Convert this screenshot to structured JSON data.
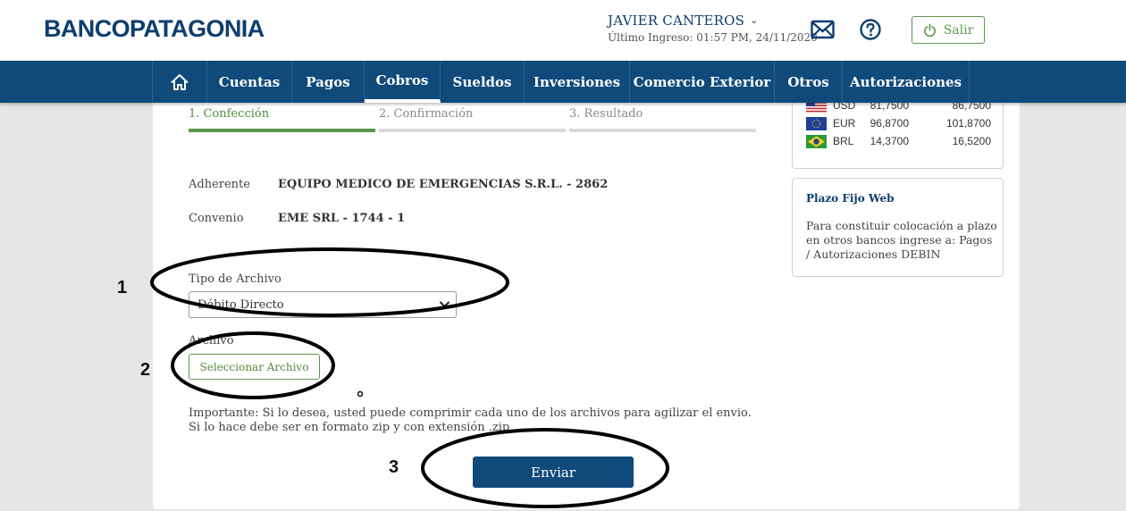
{
  "header": {
    "logo": "BANCOPATAGONIA",
    "user_name": "JAVIER CANTEROS",
    "last_login": "Último Ingreso: 01:57 PM, 24/11/2020",
    "logout_label": "Salir"
  },
  "nav": {
    "items": [
      {
        "label": "Cuentas"
      },
      {
        "label": "Pagos"
      },
      {
        "label": "Cobros",
        "active": true
      },
      {
        "label": "Sueldos"
      },
      {
        "label": "Inversiones"
      },
      {
        "label": "Comercio Exterior"
      },
      {
        "label": "Otros"
      },
      {
        "label": "Autorizaciones"
      }
    ]
  },
  "steps": [
    {
      "label": "1. Confección",
      "active": true
    },
    {
      "label": "2. Confirmación",
      "active": false
    },
    {
      "label": "3. Resultado",
      "active": false
    }
  ],
  "form": {
    "adherente_label": "Adherente",
    "adherente_value": "EQUIPO MEDICO DE EMERGENCIAS S.R.L. - 2862",
    "convenio_label": "Convenio",
    "convenio_value": "EME SRL - 1744 - 1",
    "tipo_label": "Tipo de Archivo",
    "tipo_value": "Débito Directo",
    "archivo_label": "Archivo",
    "file_button": "Seleccionar Archivo",
    "note_line1": "Importante: Si lo desea, usted puede comprimir cada uno de los archivos para agilizar el envio.",
    "note_line2": "Si lo hace debe ser en formato zip y con extensión .zip",
    "submit": "Enviar"
  },
  "exchange": {
    "rows": [
      {
        "code": "USD",
        "buy": "81,7500",
        "sell": "86,7500",
        "flag": "us-flag-icon"
      },
      {
        "code": "EUR",
        "buy": "96,8700",
        "sell": "101,8700",
        "flag": "eu-flag-icon"
      },
      {
        "code": "BRL",
        "buy": "14,3700",
        "sell": "16,5200",
        "flag": "br-flag-icon"
      }
    ]
  },
  "plazo_fijo": {
    "title": "Plazo Fijo Web",
    "text": "Para constituir colocación a plazo en otros bancos ingrese a: Pagos / Autorizaciones DEBIN"
  },
  "annotations": [
    "1",
    "2",
    "3"
  ],
  "colors": {
    "brand_blue": "#0f4a7b",
    "brand_green": "#5b9a4b",
    "background": "#e6e6e6"
  }
}
